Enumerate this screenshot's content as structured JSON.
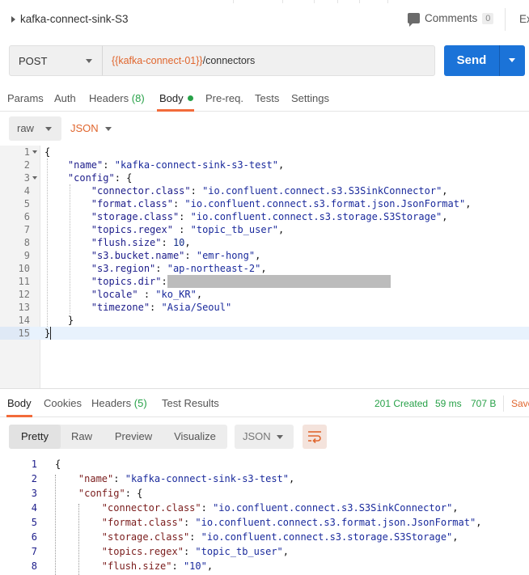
{
  "request": {
    "title": "kafka-connect-sink-S3",
    "comments_label": "Comments",
    "comments_count": "0",
    "examples_label": "Ex",
    "method": "POST",
    "url_variable": "{{kafka-connect-01}}",
    "url_path": "/connectors",
    "send_label": "Send",
    "tabs": [
      {
        "label": "Params"
      },
      {
        "label": "Auth"
      },
      {
        "label": "Headers",
        "count": "(8)"
      },
      {
        "label": "Body"
      },
      {
        "label": "Pre-req."
      },
      {
        "label": "Tests"
      },
      {
        "label": "Settings"
      }
    ],
    "body_mode": "raw",
    "body_language": "JSON",
    "code_lines": [
      {
        "n": "1",
        "text": "{"
      },
      {
        "n": "2",
        "key": "\"name\"",
        "value": "\"kafka-connect-sink-s3-test\"",
        "sep": ": ",
        "end": ","
      },
      {
        "n": "3",
        "key": "\"config\"",
        "value": "",
        "sep": ": ",
        "end": "{"
      },
      {
        "n": "4",
        "key": "\"connector.class\"",
        "value": "\"io.confluent.connect.s3.S3SinkConnector\"",
        "sep": ": ",
        "end": ","
      },
      {
        "n": "5",
        "key": "\"format.class\"",
        "value": "\"io.confluent.connect.s3.format.json.JsonFormat\"",
        "sep": ": ",
        "end": ","
      },
      {
        "n": "6",
        "key": "\"storage.class\"",
        "value": "\"io.confluent.connect.s3.storage.S3Storage\"",
        "sep": ": ",
        "end": ","
      },
      {
        "n": "7",
        "key": "\"topics.regex\"",
        "value": "\"topic_tb_user\"",
        "sep": " : ",
        "end": ","
      },
      {
        "n": "8",
        "key": "\"flush.size\"",
        "value": "10",
        "sep": ": ",
        "end": ","
      },
      {
        "n": "9",
        "key": "\"s3.bucket.name\"",
        "value": "\"emr-hong\"",
        "sep": ": ",
        "end": ","
      },
      {
        "n": "10",
        "key": "\"s3.region\"",
        "value": "\"ap-northeast-2\"",
        "sep": ": ",
        "end": ","
      },
      {
        "n": "11",
        "key": "\"topics.dir\"",
        "value": "",
        "sep": ":",
        "end": ""
      },
      {
        "n": "12",
        "key": "\"locale\"",
        "value": "\"ko_KR\"",
        "sep": " : ",
        "end": ","
      },
      {
        "n": "13",
        "key": "\"timezone\"",
        "value": "\"Asia/Seoul\"",
        "sep": ": ",
        "end": ""
      },
      {
        "n": "14",
        "text": "}"
      },
      {
        "n": "15",
        "text": "}"
      }
    ]
  },
  "response": {
    "tabs": [
      {
        "label": "Body"
      },
      {
        "label": "Cookies"
      },
      {
        "label": "Headers",
        "count": "(5)"
      },
      {
        "label": "Test Results"
      }
    ],
    "status": "201 Created",
    "time": "59 ms",
    "size": "707 B",
    "save_label": "Save",
    "views": [
      "Pretty",
      "Raw",
      "Preview",
      "Visualize"
    ],
    "format": "JSON",
    "lines": [
      {
        "n": "1",
        "text": "{"
      },
      {
        "n": "2",
        "key": "\"name\"",
        "value": "\"kafka-connect-sink-s3-test\"",
        "end": ","
      },
      {
        "n": "3",
        "key": "\"config\"",
        "value": "{",
        "end": ""
      },
      {
        "n": "4",
        "key": "\"connector.class\"",
        "value": "\"io.confluent.connect.s3.S3SinkConnector\"",
        "end": ","
      },
      {
        "n": "5",
        "key": "\"format.class\"",
        "value": "\"io.confluent.connect.s3.format.json.JsonFormat\"",
        "end": ","
      },
      {
        "n": "6",
        "key": "\"storage.class\"",
        "value": "\"io.confluent.connect.s3.storage.S3Storage\"",
        "end": ","
      },
      {
        "n": "7",
        "key": "\"topics.regex\"",
        "value": "\"topic_tb_user\"",
        "end": ","
      },
      {
        "n": "8",
        "key": "\"flush.size\"",
        "value": "\"10\"",
        "end": ","
      }
    ]
  }
}
